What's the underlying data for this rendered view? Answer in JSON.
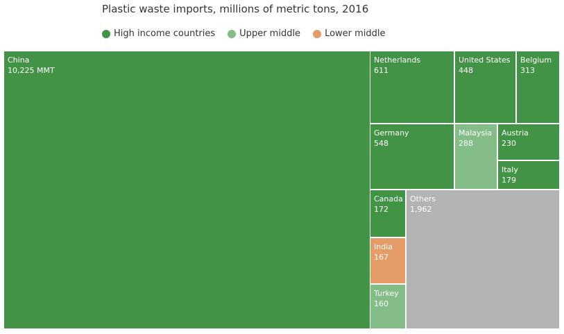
{
  "chart_data": {
    "type": "treemap",
    "title": "Plastic waste imports, millions of metric tons, 2016",
    "legend": [
      {
        "label": "High income countries",
        "color": "#439346"
      },
      {
        "label": "Upper middle",
        "color": "#84bd87"
      },
      {
        "label": "Lower middle",
        "color": "#e59c66"
      }
    ],
    "items": [
      {
        "name": "China",
        "value": 10225,
        "label": "10,225 MMT",
        "color": "#439346"
      },
      {
        "name": "Netherlands",
        "value": 611,
        "label": "611",
        "color": "#439346"
      },
      {
        "name": "United States",
        "value": 448,
        "label": "448",
        "color": "#439346"
      },
      {
        "name": "Belgium",
        "value": 313,
        "label": "313",
        "color": "#439346"
      },
      {
        "name": "Germany",
        "value": 548,
        "label": "548",
        "color": "#439346"
      },
      {
        "name": "Malaysia",
        "value": 288,
        "label": "288",
        "color": "#84bd87"
      },
      {
        "name": "Austria",
        "value": 230,
        "label": "230",
        "color": "#439346"
      },
      {
        "name": "Italy",
        "value": 179,
        "label": "179",
        "color": "#439346"
      },
      {
        "name": "Canada",
        "value": 172,
        "label": "172",
        "color": "#439346"
      },
      {
        "name": "India",
        "value": 167,
        "label": "167",
        "color": "#e59c66"
      },
      {
        "name": "Turkey",
        "value": 160,
        "label": "160",
        "color": "#84bd87"
      },
      {
        "name": "Others",
        "value": 1962,
        "label": "1,962",
        "color": "#b3b3b3"
      }
    ]
  }
}
